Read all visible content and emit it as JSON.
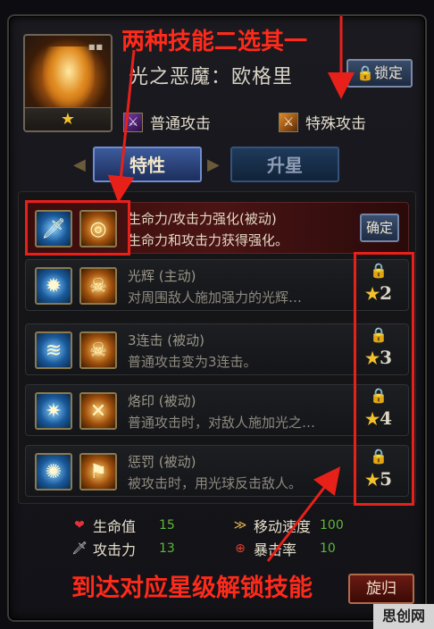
{
  "header": {
    "hero_name": "光之恶魔：欧格里",
    "lock_label": "锁定",
    "rank_star": "★"
  },
  "attacks": {
    "normal_label": "普通攻击",
    "special_label": "特殊攻击"
  },
  "tabs": [
    {
      "label": "特性",
      "active": true
    },
    {
      "label": "升星",
      "active": false
    }
  ],
  "skills": [
    {
      "title": "生命力/攻击力强化(被动)",
      "desc": "生命力和攻击力获得强化。",
      "selected": true,
      "confirm_label": "确定",
      "locked": false,
      "stars_required": null
    },
    {
      "title": "光辉 (主动)",
      "desc": "对周围敌人施加强力的光辉…",
      "selected": false,
      "locked": true,
      "stars_required": "2"
    },
    {
      "title": "3连击 (被动)",
      "desc": "普通攻击变为3连击。",
      "selected": false,
      "locked": true,
      "stars_required": "3"
    },
    {
      "title": "烙印 (被动)",
      "desc": "普通攻击时，对敌人施加光之…",
      "selected": false,
      "locked": true,
      "stars_required": "4"
    },
    {
      "title": "惩罚 (被动)",
      "desc": "被攻击时，用光球反击敌人。",
      "selected": false,
      "locked": true,
      "stars_required": "5"
    }
  ],
  "stats": {
    "hp_label": "生命值",
    "hp_value": "15",
    "atk_label": "攻击力",
    "atk_value": "13",
    "speed_label": "移动速度",
    "speed_value": "100",
    "crit_label": "暴击率",
    "crit_value": "10"
  },
  "return_label": "旋归",
  "annotations": {
    "top_text": "两种技能二选其一",
    "bottom_text": "到达对应星级解锁技能"
  },
  "watermark": "思创网",
  "colors": {
    "annotation_red": "#e8201a",
    "star_gold": "#f3c12c",
    "stat_value_green": "#5fb83a"
  }
}
